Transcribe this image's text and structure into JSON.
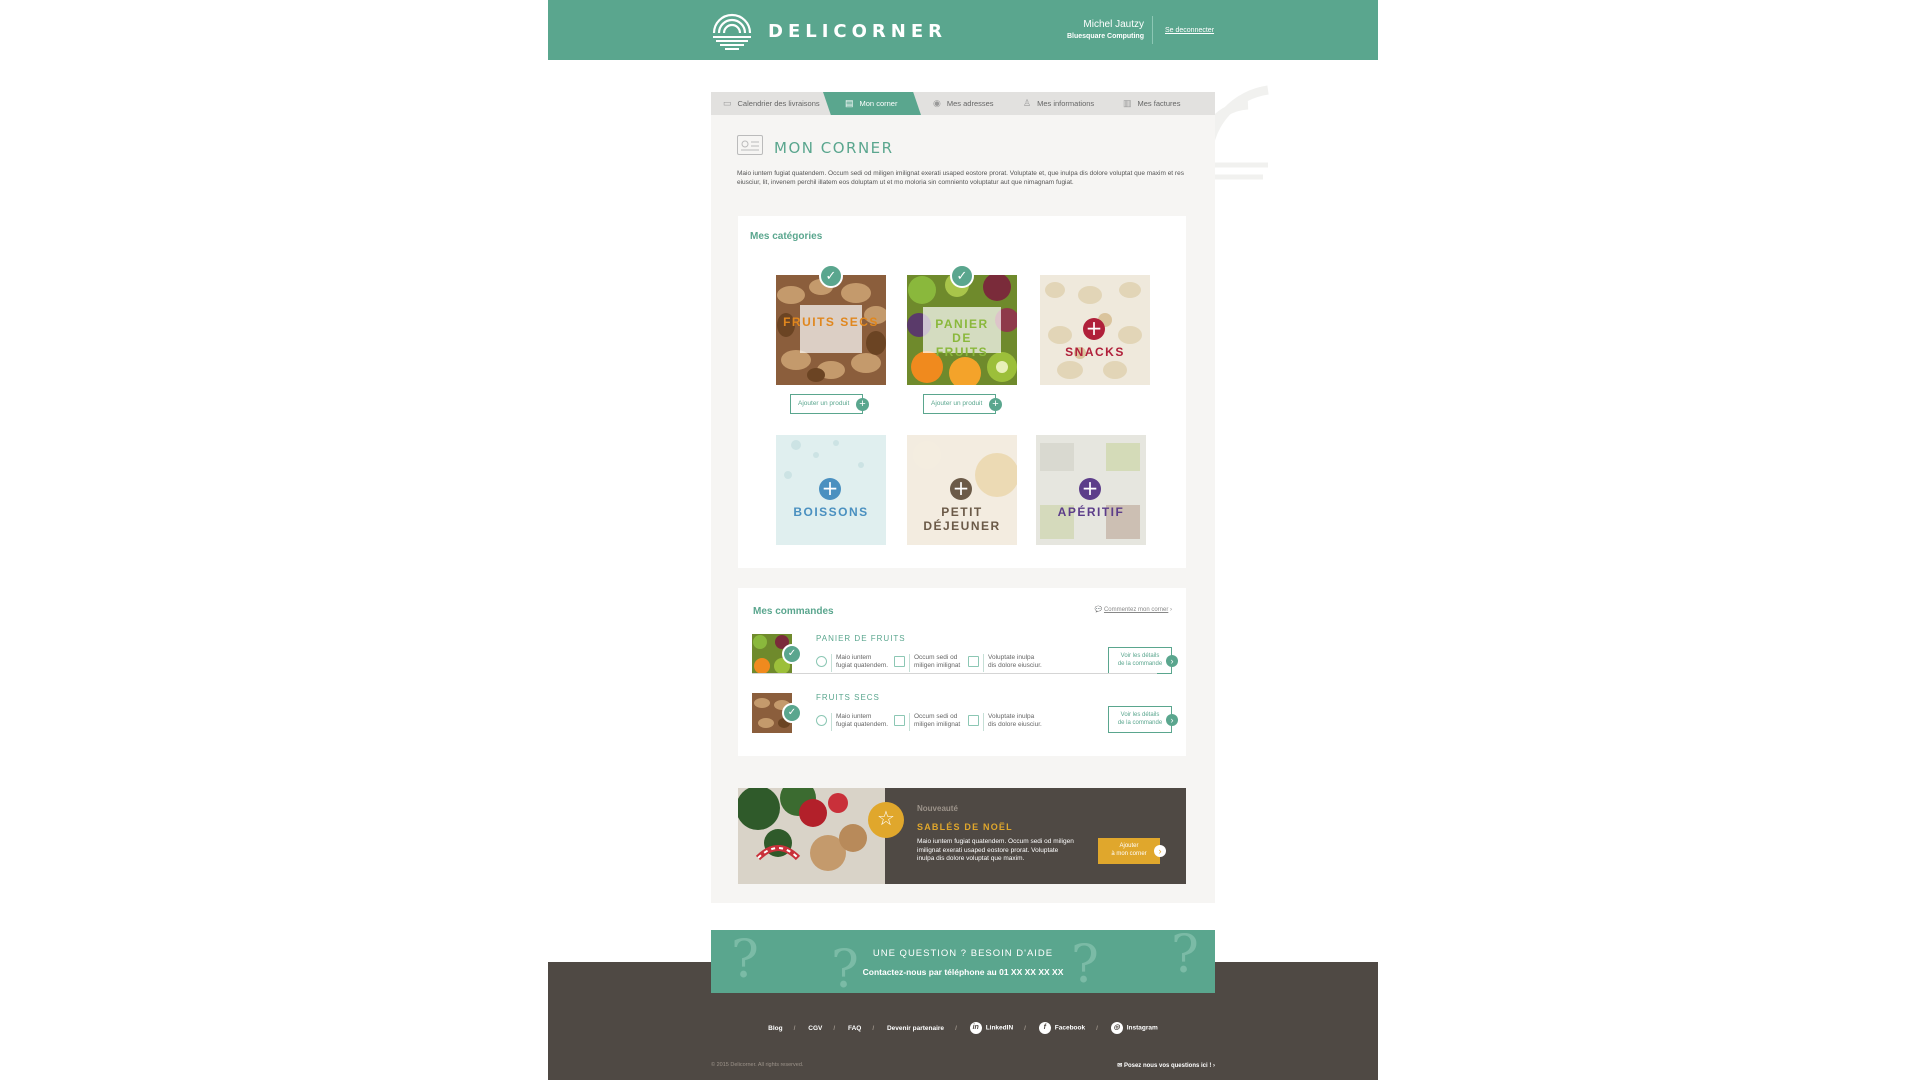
{
  "header": {
    "brand": "DELICORNER",
    "user_name": "Michel Jautzy",
    "company": "Bluesquare Computing",
    "logout": "Se deconnecter"
  },
  "tabs": [
    {
      "label": "Calendrier des livraisons",
      "icon": "calendar-icon",
      "active": false
    },
    {
      "label": "Mon corner",
      "icon": "corner-icon",
      "active": true
    },
    {
      "label": "Mes adresses",
      "icon": "location-pin-icon",
      "active": false
    },
    {
      "label": "Mes informations",
      "icon": "user-icon",
      "active": false
    },
    {
      "label": "Mes factures",
      "icon": "invoice-icon",
      "active": false
    }
  ],
  "page": {
    "title": "MON CORNER",
    "intro": "Maio iuntem fugiat quatendem. Occum sedi od miligen imilignat exerati usaped eostore prorat. Voluptate et, que inulpa dis dolore voluptat que maxim et res eiusciur, lit, invenem perchil illatem eos doluptam ut et mo moloria sin comniento voluptatur aut que nimagnam fugiat."
  },
  "categories": {
    "title": "Mes catégories",
    "items": [
      {
        "label": "FRUITS SECS",
        "state": "selected",
        "add_label": "Ajouter un produit"
      },
      {
        "label": "PANIER DE FRUITS",
        "state": "selected",
        "add_label": "Ajouter un produit"
      },
      {
        "label": "SNACKS",
        "state": "available",
        "color": "#b0203a"
      },
      {
        "label": "BOISSONS",
        "state": "available",
        "color": "#4a90c0"
      },
      {
        "label": "PETIT DÉJEUNER",
        "state": "available",
        "color": "#6b5a48"
      },
      {
        "label": "APÉRITIF",
        "state": "available",
        "color": "#5c3d8a"
      }
    ]
  },
  "orders": {
    "title": "Mes commandes",
    "comment_link": "Commentez mon corner",
    "rows": [
      {
        "name": "PANIER DE FRUITS",
        "col1": "Maio iuntem\nfugiat quatendem.",
        "col2": "Occum sedi od\nmiligen imilignat",
        "col3": "Voluptate inulpa\ndis dolore eiusciur.",
        "details": "Voir les détails\nde la commande"
      },
      {
        "name": "FRUITS SECS",
        "col1": "Maio iuntem\nfugiat quatendem.",
        "col2": "Occum sedi od\nmiligen imilignat",
        "col3": "Voluptate inulpa\ndis dolore eiusciur.",
        "details": "Voir les détails\nde la commande"
      }
    ]
  },
  "promo": {
    "badge": "Nouveauté",
    "title": "SABLÉS DE NOËL",
    "text": "Maio iuntem fugiat quatendem. Occum sedi od miligen imilignat exerati usaped eostore prorat. Voluptate inulpa dis dolore voluptat que maxim.",
    "button": "Ajouter\nà mon corner"
  },
  "help": {
    "title": "UNE QUESTION ? BESOIN D'AIDE",
    "phone": "Contactez-nous par téléphone au 01 XX XX XX XX"
  },
  "footer": {
    "links": [
      "Blog",
      "CGV",
      "FAQ",
      "Devenir partenaire"
    ],
    "social": [
      {
        "label": "LinkedIN",
        "glyph": "in"
      },
      {
        "label": "Facebook",
        "glyph": "f"
      },
      {
        "label": "Instagram",
        "glyph": "◎"
      }
    ],
    "copyright": "© 2015 Delicorner. All rights reserved.",
    "ask": "Posez nous vos questions ici !"
  },
  "colors": {
    "primary": "#5aa68e",
    "dark": "#4f4944",
    "accent": "#e0a72c"
  }
}
